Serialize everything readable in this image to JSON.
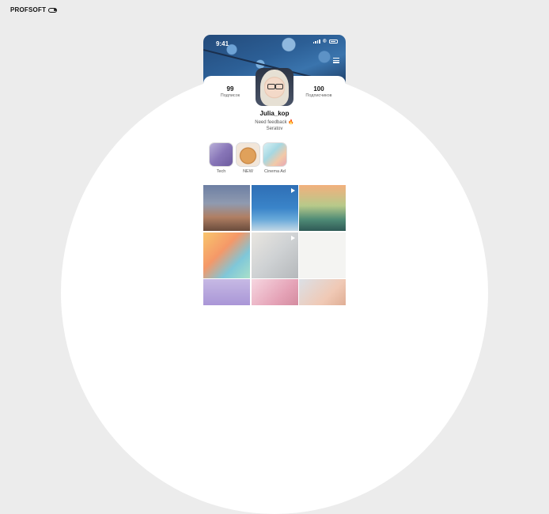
{
  "brand": {
    "name": "PROFSOFT"
  },
  "status_bar": {
    "time": "9:41"
  },
  "profile": {
    "following_count": "99",
    "following_label": "Подписок",
    "followers_count": "100",
    "followers_label": "Подписчиков",
    "username": "Julia_kop",
    "bio_line1": "Need feedback",
    "bio_line2": "Seratov"
  },
  "highlights": [
    {
      "label": "Tech"
    },
    {
      "label": "NEW"
    },
    {
      "label": "Cinema Ad"
    }
  ],
  "icons": {
    "menu": "hamburger-menu-icon",
    "play": "video-play-icon",
    "fire": "fire-emoji"
  }
}
